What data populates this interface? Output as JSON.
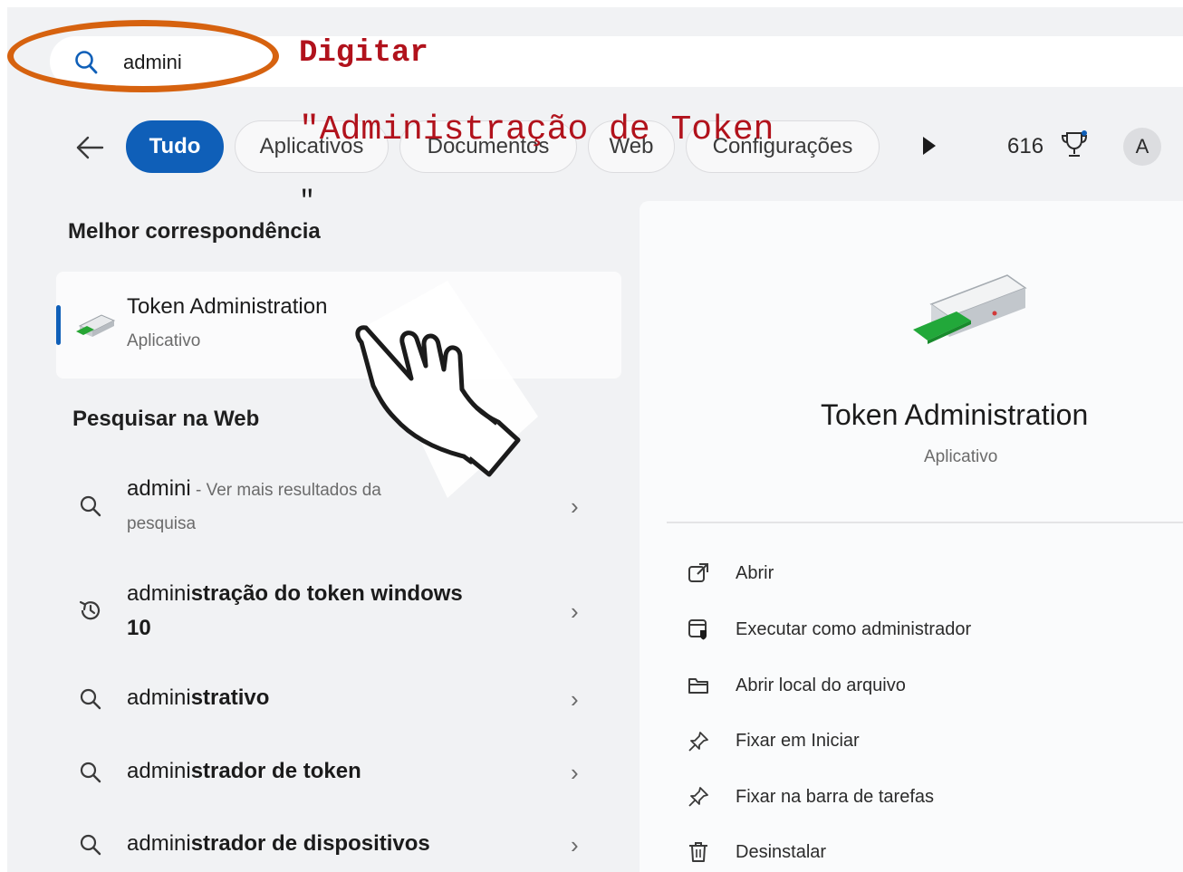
{
  "search": {
    "query": "admini"
  },
  "annotation": {
    "line1": "Digitar",
    "line2": "\"Administração de Token",
    "line3": "\""
  },
  "tabs": [
    {
      "label": "Tudo",
      "active": true
    },
    {
      "label": "Aplicativos",
      "active": false
    },
    {
      "label": "Documentos",
      "active": false
    },
    {
      "label": "Web",
      "active": false
    },
    {
      "label": "Configurações",
      "active": false
    }
  ],
  "header": {
    "points": "616",
    "avatar_letter": "A"
  },
  "best_match": {
    "heading": "Melhor correspondência",
    "title": "Token Administration",
    "subtitle": "Aplicativo"
  },
  "web_search": {
    "heading": "Pesquisar na Web",
    "items": [
      {
        "prefix": "admini",
        "bold": "",
        "extra": " - Ver mais resultados da",
        "line2": "pesquisa",
        "icon": "search-icon"
      },
      {
        "prefix": "admini",
        "bold": "stração do token windows",
        "extra": "",
        "line2": "10",
        "icon": "history-icon"
      },
      {
        "prefix": "admini",
        "bold": "strativo",
        "extra": "",
        "line2": "",
        "icon": "search-icon"
      },
      {
        "prefix": "admini",
        "bold": "strador de token",
        "extra": "",
        "line2": "",
        "icon": "search-icon"
      },
      {
        "prefix": "admini",
        "bold": "strador de dispositivos",
        "extra": "",
        "line2": "",
        "icon": "search-icon"
      }
    ]
  },
  "detail": {
    "title": "Token Administration",
    "subtitle": "Aplicativo",
    "actions": [
      {
        "label": "Abrir",
        "icon": "open-external-icon"
      },
      {
        "label": "Executar como administrador",
        "icon": "run-as-admin-icon"
      },
      {
        "label": "Abrir local do arquivo",
        "icon": "folder-icon"
      },
      {
        "label": "Fixar em Iniciar",
        "icon": "pin-icon"
      },
      {
        "label": "Fixar na barra de tarefas",
        "icon": "pin-icon"
      },
      {
        "label": "Desinstalar",
        "icon": "trash-icon"
      }
    ]
  },
  "colors": {
    "accent": "#0f5fb8",
    "annotation_red": "#b1121c",
    "annotation_orange": "#d6620f"
  }
}
